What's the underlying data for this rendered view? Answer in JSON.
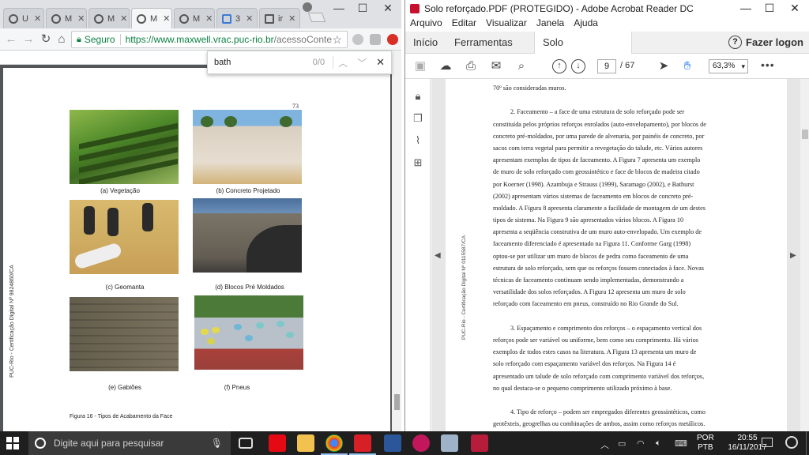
{
  "chrome": {
    "tabs": [
      {
        "label": "U"
      },
      {
        "label": "M"
      },
      {
        "label": "M"
      },
      {
        "label": "M"
      },
      {
        "label": "M"
      },
      {
        "label": "3"
      },
      {
        "label": "ir"
      }
    ],
    "window_controls": {
      "minimize": "—",
      "maximize": "☐",
      "close": "✕"
    },
    "address": {
      "secure_label": "Seguro",
      "url_host": "https://www.maxwell.vrac.puc-rio.br",
      "url_path": "/acessoConteudo..."
    },
    "find": {
      "query": "bath",
      "count": "0/0"
    },
    "page": {
      "page_number": "73",
      "side_text": "PUC-Rio - Certificação Digital Nº 9824860/CA",
      "figures": [
        {
          "caption": "(a) Vegetação"
        },
        {
          "caption": "(b) Concreto Projetado"
        },
        {
          "caption": "(c) Geomanta"
        },
        {
          "caption": "(d) Blocos Pré Moldados"
        },
        {
          "caption": "(e) Gabiões"
        },
        {
          "caption": "(f) Pneus"
        }
      ],
      "figure_caption": "Figura 16 - Tipos de Acabamento da Face"
    }
  },
  "acrobat": {
    "title": "Solo reforçado.PDF (PROTEGIDO) - Adobe Acrobat Reader DC",
    "window_controls": {
      "minimize": "—",
      "maximize": "☐",
      "close": "✕"
    },
    "menu": [
      "Arquivo",
      "Editar",
      "Visualizar",
      "Janela",
      "Ajuda"
    ],
    "tabs": {
      "home": "Início",
      "tools": "Ferramentas",
      "document": "Solo reforçado.PDF",
      "help": "?",
      "logon": "Fazer logon"
    },
    "toolbar": {
      "page_current": "9",
      "page_total": "/ 67",
      "zoom": "63,3%",
      "more": "•••"
    },
    "page": {
      "side_text": "PUC-Rio - Certificação Digital Nº 0115587/CA",
      "lines": [
        "70º são consideradas muros.",
        "",
        "2. Faceamento – a face de uma estrutura de solo reforçado pode ser",
        "constituída pelos próprios reforços enrolados (auto-envelopamento), por blocos de",
        "concreto pré-moldados, por uma parede de alvenaria, por painéis de concreto, por",
        "sacos com terra vegetal para permitir a revegetação do talude, etc. Vários autores",
        "apresentam exemplos de tipos de faceamento. A Figura 7 apresenta um exemplo",
        "de muro de solo reforçado com geossintético e face de blocos de madeira citado",
        "por Koerner (1998). Azambuja e Strauss (1999), Saramago (2002), e Bathurst",
        "(2002) apresentam vários sistemas de faceamento em blocos de concreto pré-",
        "moldado. A Figura 8 apresenta claramente a facilidade de montagem de um destes",
        "tipos de sistema. Na Figura 9 são apresentados vários blocos. A Figura 10",
        "apresenta a seqüência construtiva de um muro auto-envelopado. Um exemplo de",
        "faceamento diferenciado é apresentado na Figura 11. Conforme Garg (1998)",
        "optou-se por utilizar um muro de blocos de pedra como faceamento de uma",
        "estrutura de solo reforçado, sem que os reforços fossem conectados à face. Novas",
        "técnicas de faceamento continuam sendo implementadas, demonstrando a",
        "versatilidade dos solos reforçados. A Figura 12 apresenta um muro de solo",
        "reforçado com faceamento em pneus, construído no Rio Grande do Sul.",
        "",
        "3. Espaçamento e comprimento dos reforços – o espaçamento vertical dos",
        "reforços pode ser variável ou uniforme, bem como seu comprimento. Há vários",
        "exemplos de todos estes casos na literatura. A Figura 13 apresenta um muro de",
        "solo reforçado com espaçamento variável dos reforços. Na Figura 14 é",
        "apresentado um talude de solo reforçado com comprimento variável dos reforços,",
        "no qual destaca-se o pequeno comprimento utilizado próximo à base.",
        "",
        "4. Tipo de reforço – podem ser empregados diferentes geossintéticos, como",
        "geotêxteis, geogrelhas ou combinações de ambos, assim como reforços metálicos."
      ]
    }
  },
  "taskbar": {
    "search_placeholder": "Digite aqui para pesquisar",
    "lang_line1": "POR",
    "lang_line2": "PTB",
    "time": "20:55",
    "date": "16/11/2017"
  }
}
